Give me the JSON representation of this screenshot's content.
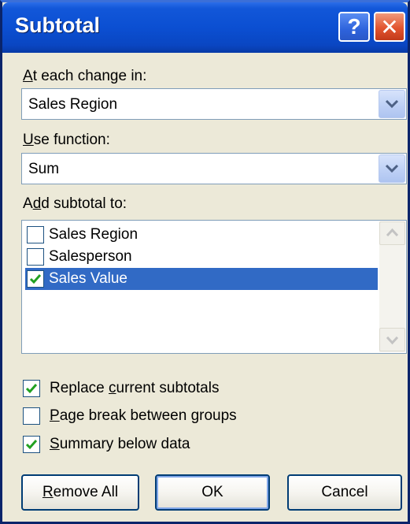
{
  "dialog": {
    "title": "Subtotal",
    "help_glyph": "?",
    "close_glyph": "✕"
  },
  "change_in": {
    "label_u": "A",
    "label_rest": "t each change in:",
    "value": "Sales Region"
  },
  "use_function": {
    "label_u": "U",
    "label_rest": "se function:",
    "value": "Sum"
  },
  "add_subtotal": {
    "label_pre": "A",
    "label_u": "d",
    "label_rest": "d subtotal to:",
    "items": [
      {
        "label": "Sales Region",
        "checked": false,
        "selected": false
      },
      {
        "label": "Salesperson",
        "checked": false,
        "selected": false
      },
      {
        "label": "Sales Value",
        "checked": true,
        "selected": true
      }
    ]
  },
  "options": {
    "replace": {
      "pre": "Replace ",
      "u": "c",
      "rest": "urrent subtotals",
      "checked": true
    },
    "page_break": {
      "pre": "",
      "u": "P",
      "rest": "age break between groups",
      "checked": false
    },
    "summary": {
      "pre": "",
      "u": "S",
      "rest": "ummary below data",
      "checked": true
    }
  },
  "buttons": {
    "remove_all_u": "R",
    "remove_all_rest": "emove All",
    "ok": "OK",
    "cancel": "Cancel"
  },
  "colors": {
    "title_bar": "#0b4fd2",
    "selection": "#316ac5",
    "check_mark": "#21a121"
  }
}
